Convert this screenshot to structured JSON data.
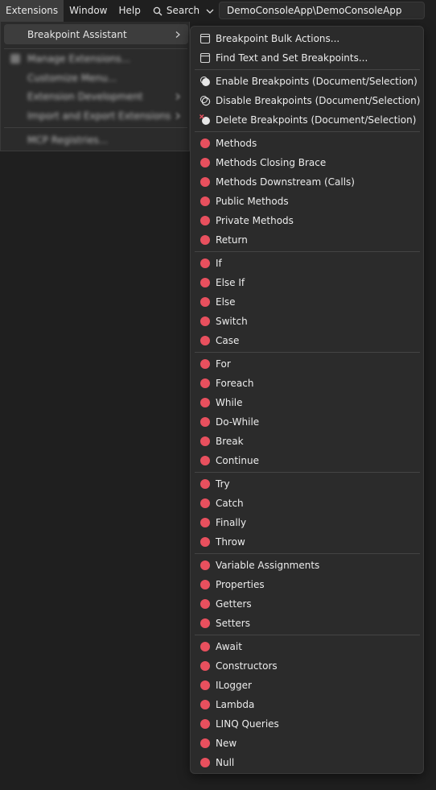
{
  "menubar": {
    "items": [
      "Extensions",
      "Window",
      "Help"
    ],
    "search_label": "Search",
    "title": "DemoConsoleApp\\DemoConsoleApp"
  },
  "extensions_menu": {
    "items": [
      {
        "label": "Breakpoint Assistant",
        "submenu": true
      },
      {
        "label": "Manage Extensions...",
        "blurred": true
      },
      {
        "label": "Customize Menu...",
        "blurred": true
      },
      {
        "label": "Extension Development",
        "blurred": true,
        "submenu": true
      },
      {
        "label": "Import and Export Extensions",
        "blurred": true,
        "submenu": true
      },
      {
        "label": "MCP Registries...",
        "blurred": true
      }
    ]
  },
  "submenu": {
    "groups": [
      [
        {
          "label": "Breakpoint Bulk Actions...",
          "icon": "window-icon"
        },
        {
          "label": "Find Text and Set Breakpoints...",
          "icon": "window-icon"
        }
      ],
      [
        {
          "label": "Enable Breakpoints (Document/Selection)",
          "icon": "enable-breakpoints-icon"
        },
        {
          "label": "Disable Breakpoints (Document/Selection)",
          "icon": "disable-breakpoints-icon"
        },
        {
          "label": "Delete Breakpoints (Document/Selection)",
          "icon": "delete-breakpoints-icon"
        }
      ],
      [
        {
          "label": "Methods",
          "icon": "breakpoint-dot-icon"
        },
        {
          "label": "Methods Closing Brace",
          "icon": "breakpoint-dot-icon"
        },
        {
          "label": "Methods Downstream (Calls)",
          "icon": "breakpoint-dot-icon"
        },
        {
          "label": "Public Methods",
          "icon": "breakpoint-dot-icon"
        },
        {
          "label": "Private Methods",
          "icon": "breakpoint-dot-icon"
        },
        {
          "label": "Return",
          "icon": "breakpoint-dot-icon"
        }
      ],
      [
        {
          "label": "If",
          "icon": "breakpoint-dot-icon"
        },
        {
          "label": "Else If",
          "icon": "breakpoint-dot-icon"
        },
        {
          "label": "Else",
          "icon": "breakpoint-dot-icon"
        },
        {
          "label": "Switch",
          "icon": "breakpoint-dot-icon"
        },
        {
          "label": "Case",
          "icon": "breakpoint-dot-icon"
        }
      ],
      [
        {
          "label": "For",
          "icon": "breakpoint-dot-icon"
        },
        {
          "label": "Foreach",
          "icon": "breakpoint-dot-icon"
        },
        {
          "label": "While",
          "icon": "breakpoint-dot-icon"
        },
        {
          "label": "Do-While",
          "icon": "breakpoint-dot-icon"
        },
        {
          "label": "Break",
          "icon": "breakpoint-dot-icon"
        },
        {
          "label": "Continue",
          "icon": "breakpoint-dot-icon"
        }
      ],
      [
        {
          "label": "Try",
          "icon": "breakpoint-dot-icon"
        },
        {
          "label": "Catch",
          "icon": "breakpoint-dot-icon"
        },
        {
          "label": "Finally",
          "icon": "breakpoint-dot-icon"
        },
        {
          "label": "Throw",
          "icon": "breakpoint-dot-icon"
        }
      ],
      [
        {
          "label": "Variable Assignments",
          "icon": "breakpoint-dot-icon"
        },
        {
          "label": "Properties",
          "icon": "breakpoint-dot-icon"
        },
        {
          "label": "Getters",
          "icon": "breakpoint-dot-icon"
        },
        {
          "label": "Setters",
          "icon": "breakpoint-dot-icon"
        }
      ],
      [
        {
          "label": "Await",
          "icon": "breakpoint-dot-icon"
        },
        {
          "label": "Constructors",
          "icon": "breakpoint-dot-icon"
        },
        {
          "label": "ILogger",
          "icon": "breakpoint-dot-icon"
        },
        {
          "label": "Lambda",
          "icon": "breakpoint-dot-icon"
        },
        {
          "label": "LINQ Queries",
          "icon": "breakpoint-dot-icon"
        },
        {
          "label": "New",
          "icon": "breakpoint-dot-icon"
        },
        {
          "label": "Null",
          "icon": "breakpoint-dot-icon"
        }
      ]
    ]
  },
  "colors": {
    "background": "#1f1f1f",
    "menu_bg": "#2b2b2b",
    "highlight": "#3d3d3d",
    "breakpoint_red": "#e8505e"
  }
}
